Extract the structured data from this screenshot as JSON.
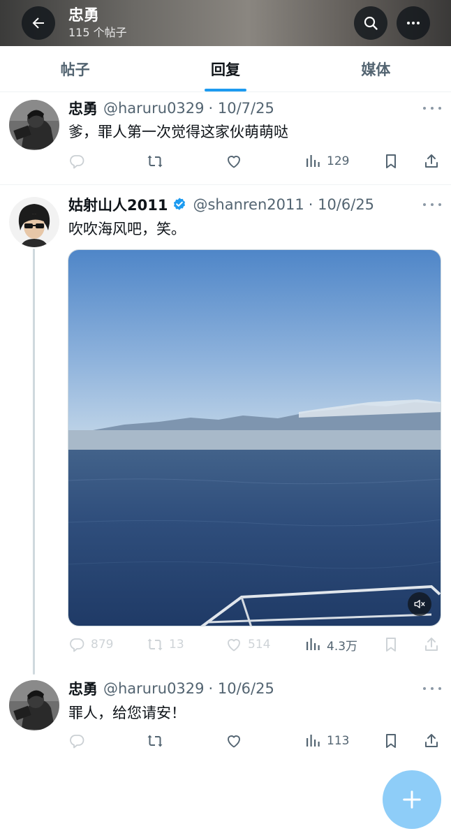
{
  "header": {
    "title": "忠勇",
    "subtitle": "115 个帖子"
  },
  "tabs": [
    {
      "label": "帖子",
      "active": false
    },
    {
      "label": "回复",
      "active": true
    },
    {
      "label": "媒体",
      "active": false
    }
  ],
  "tweets": [
    {
      "name": "忠勇",
      "handle": "@haruru0329",
      "date": "· 10/7/25",
      "text": "爹，罪人第一次觉得这家伙萌萌哒",
      "replies": "",
      "reposts": "",
      "likes": "",
      "views": "129",
      "verified": false
    },
    {
      "name": "姑射山人2011",
      "handle": "@shanren2011",
      "date": "· 10/6/25",
      "text": "吹吹海风吧，笑。",
      "replies": "879",
      "reposts": "13",
      "likes": "514",
      "views": "4.3万",
      "verified": true,
      "has_video": true
    },
    {
      "name": "忠勇",
      "handle": "@haruru0329",
      "date": "· 10/6/25",
      "text": "罪人，给您请安！",
      "replies": "",
      "reposts": "",
      "likes": "",
      "views": "113",
      "verified": false
    }
  ],
  "colors": {
    "accent": "#1d9bf0",
    "fab": "#8ecdf8",
    "secondary_text": "#536471"
  },
  "icons": [
    "back-arrow-icon",
    "search-icon",
    "more-icon",
    "reply-icon",
    "repost-icon",
    "like-icon",
    "views-icon",
    "bookmark-icon",
    "share-icon",
    "verified-icon",
    "mute-icon",
    "plus-icon"
  ]
}
